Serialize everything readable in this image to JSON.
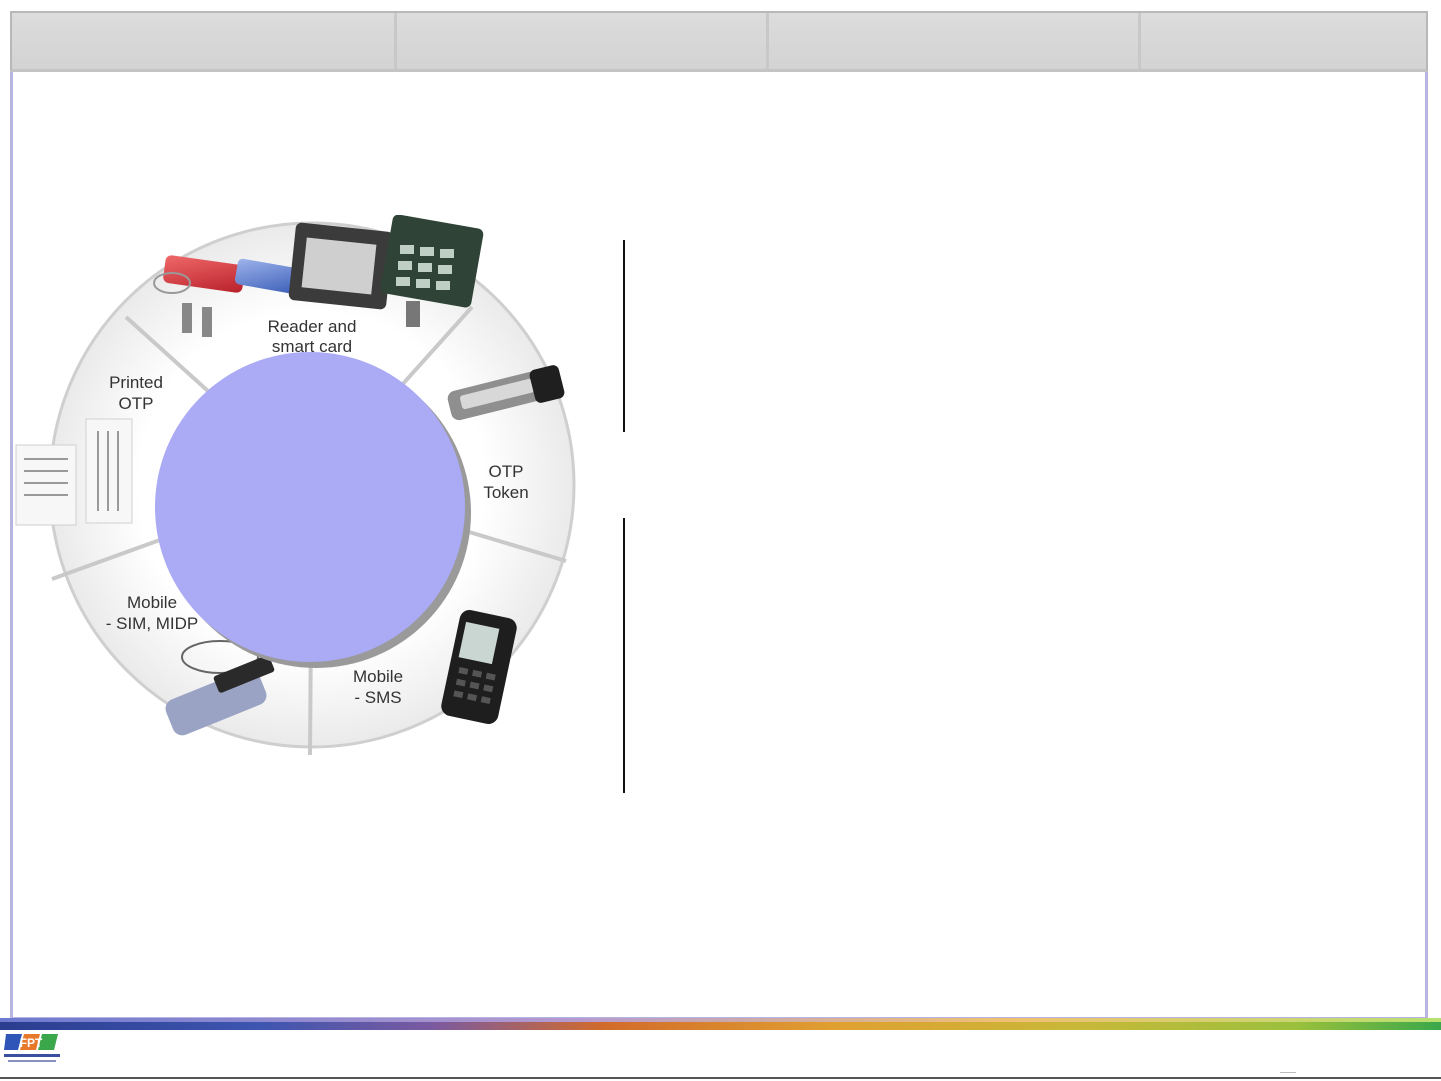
{
  "tabs": [
    {
      "label": ""
    },
    {
      "label": ""
    },
    {
      "label": ""
    },
    {
      "label": ""
    }
  ],
  "wheel": {
    "segments": [
      {
        "label_line1": "Reader and",
        "label_line2": "smart card"
      },
      {
        "label_line1": "OTP",
        "label_line2": "Token"
      },
      {
        "label_line1": "Mobile",
        "label_line2": "- SMS"
      },
      {
        "label_line1": "Mobile",
        "label_line2": "- SIM, MIDP"
      },
      {
        "label_line1": "Printed",
        "label_line2": "OTP"
      }
    ],
    "center_label": "",
    "center_color": "#aaaaf5",
    "segment_color": "#f2f2f2"
  },
  "footer": {
    "logo_text": "FPT"
  }
}
